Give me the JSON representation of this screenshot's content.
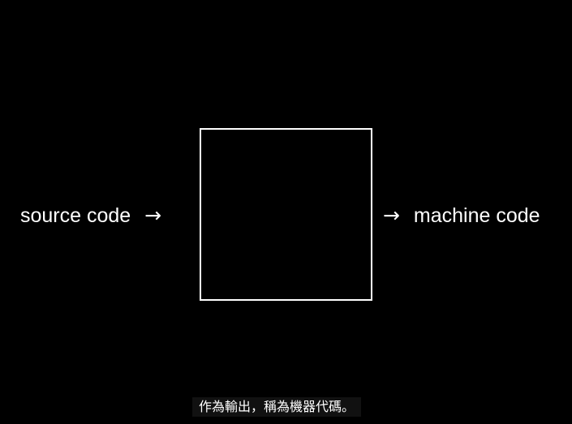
{
  "diagram": {
    "input_label": "source code",
    "output_label": "machine code",
    "arrow_glyph": "→"
  },
  "subtitle": {
    "text": "作為輸出，稱為機器代碼。"
  },
  "colors": {
    "background": "#000000",
    "foreground": "#ffffff"
  }
}
